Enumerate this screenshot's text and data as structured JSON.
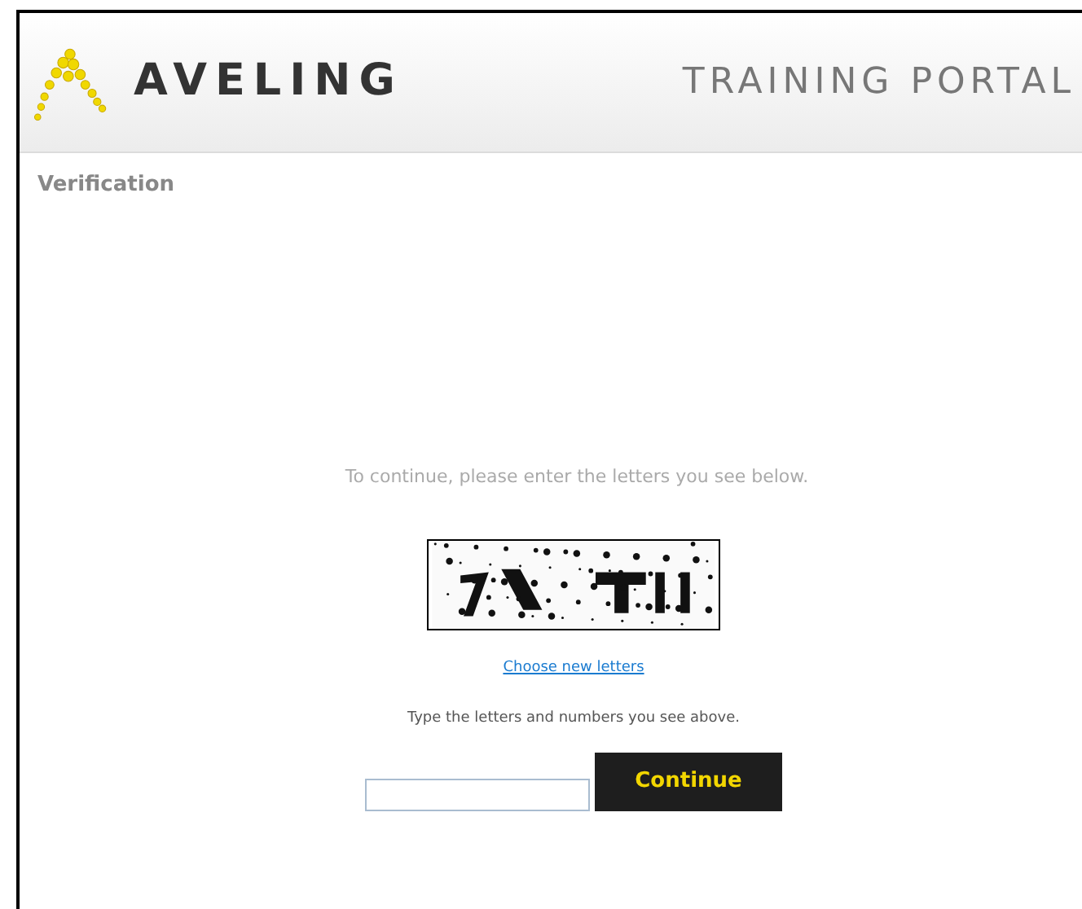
{
  "header": {
    "brand": "AVELING",
    "portal": "TRAINING PORTAL"
  },
  "page_title": "Verification",
  "instruction": "To continue, please enter the letters you see below.",
  "new_letters_link": "Choose new letters",
  "hint": "Type the letters and numbers you see above.",
  "continue_button": "Continue"
}
